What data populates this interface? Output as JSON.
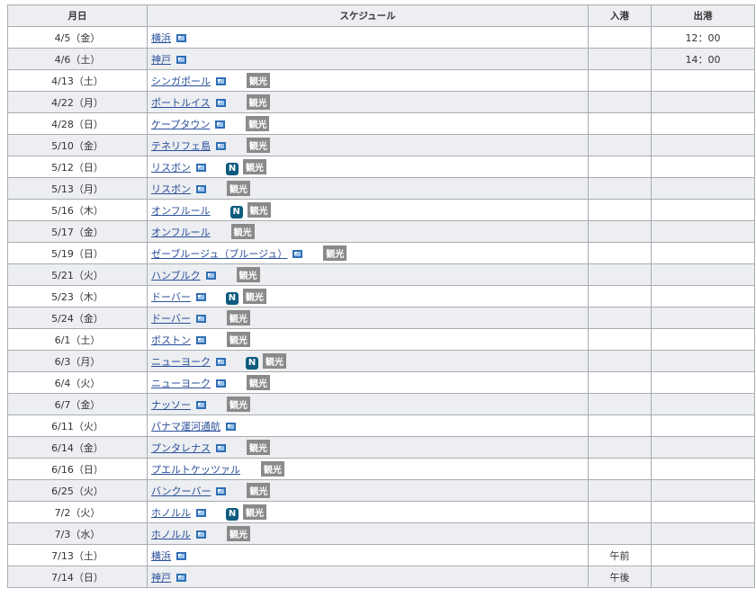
{
  "headers": [
    "月日",
    "スケジュール",
    "入港",
    "出港"
  ],
  "badges": {
    "n": "N",
    "kanko": "観光"
  },
  "rows": [
    {
      "date": "4/5（金）",
      "port": "横浜",
      "pic": true,
      "n": false,
      "k": false,
      "in": "",
      "out": "12：00"
    },
    {
      "date": "4/6（土）",
      "port": "神戸",
      "pic": true,
      "n": false,
      "k": false,
      "in": "",
      "out": "14：00"
    },
    {
      "date": "4/13（土）",
      "port": "シンガポール",
      "pic": true,
      "n": false,
      "k": true,
      "in": "",
      "out": ""
    },
    {
      "date": "4/22（月）",
      "port": "ポートルイス",
      "pic": true,
      "n": false,
      "k": true,
      "in": "",
      "out": ""
    },
    {
      "date": "4/28（日）",
      "port": "ケープタウン",
      "pic": true,
      "n": false,
      "k": true,
      "in": "",
      "out": ""
    },
    {
      "date": "5/10（金）",
      "port": "テネリフェ島",
      "pic": true,
      "n": false,
      "k": true,
      "in": "",
      "out": ""
    },
    {
      "date": "5/12（日）",
      "port": "リスボン",
      "pic": true,
      "n": true,
      "k": true,
      "in": "",
      "out": ""
    },
    {
      "date": "5/13（月）",
      "port": "リスボン",
      "pic": true,
      "n": false,
      "k": true,
      "in": "",
      "out": ""
    },
    {
      "date": "5/16（木）",
      "port": "オンフルール",
      "pic": false,
      "n": true,
      "k": true,
      "in": "",
      "out": ""
    },
    {
      "date": "5/17（金）",
      "port": "オンフルール",
      "pic": false,
      "n": false,
      "k": true,
      "in": "",
      "out": ""
    },
    {
      "date": "5/19（日）",
      "port": "ゼーブルージュ（ブルージュ）",
      "pic": true,
      "n": false,
      "k": true,
      "in": "",
      "out": ""
    },
    {
      "date": "5/21（火）",
      "port": "ハンブルク",
      "pic": true,
      "n": false,
      "k": true,
      "in": "",
      "out": ""
    },
    {
      "date": "5/23（木）",
      "port": "ドーバー",
      "pic": true,
      "n": true,
      "k": true,
      "in": "",
      "out": ""
    },
    {
      "date": "5/24（金）",
      "port": "ドーバー",
      "pic": true,
      "n": false,
      "k": true,
      "in": "",
      "out": ""
    },
    {
      "date": "6/1（土）",
      "port": "ボストン",
      "pic": true,
      "n": false,
      "k": true,
      "in": "",
      "out": ""
    },
    {
      "date": "6/3（月）",
      "port": "ニューヨーク",
      "pic": true,
      "n": true,
      "k": true,
      "in": "",
      "out": ""
    },
    {
      "date": "6/4（火）",
      "port": "ニューヨーク",
      "pic": true,
      "n": false,
      "k": true,
      "in": "",
      "out": ""
    },
    {
      "date": "6/7（金）",
      "port": "ナッソー",
      "pic": true,
      "n": false,
      "k": true,
      "in": "",
      "out": ""
    },
    {
      "date": "6/11（火）",
      "port": "パナマ運河通航",
      "pic": true,
      "n": false,
      "k": false,
      "in": "",
      "out": ""
    },
    {
      "date": "6/14（金）",
      "port": "プンタレナス",
      "pic": true,
      "n": false,
      "k": true,
      "in": "",
      "out": ""
    },
    {
      "date": "6/16（日）",
      "port": "プエルトケッツァル",
      "pic": false,
      "n": false,
      "k": true,
      "in": "",
      "out": ""
    },
    {
      "date": "6/25（火）",
      "port": "バンクーバー",
      "pic": true,
      "n": false,
      "k": true,
      "in": "",
      "out": ""
    },
    {
      "date": "7/2（火）",
      "port": "ホノルル",
      "pic": true,
      "n": true,
      "k": true,
      "in": "",
      "out": ""
    },
    {
      "date": "7/3（水）",
      "port": "ホノルル",
      "pic": true,
      "n": false,
      "k": true,
      "in": "",
      "out": ""
    },
    {
      "date": "7/13（土）",
      "port": "横浜",
      "pic": true,
      "n": false,
      "k": false,
      "in": "午前",
      "out": ""
    },
    {
      "date": "7/14（日）",
      "port": "神戸",
      "pic": true,
      "n": false,
      "k": false,
      "in": "午後",
      "out": ""
    }
  ]
}
